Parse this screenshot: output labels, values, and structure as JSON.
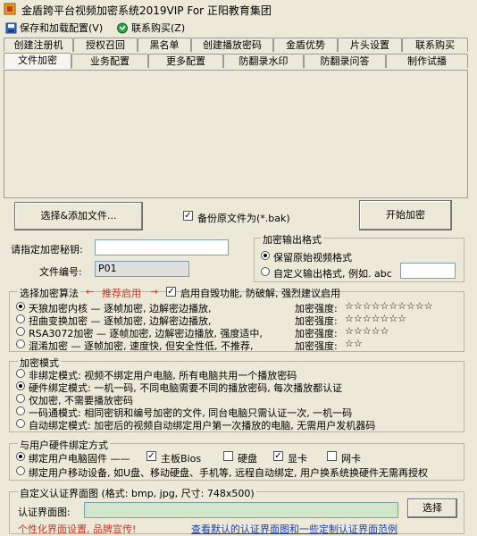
{
  "window": {
    "title": "金盾跨平台视频加密系统2019VIP For 正阳教育集团"
  },
  "menu": {
    "save_load": "保存和加载配置(V)",
    "contact": "联系购买(Z)"
  },
  "tabs_row1": [
    "创建注册机",
    "授权召回",
    "黑名单",
    "创建播放密码",
    "金盾优势",
    "片头设置",
    "联系购买"
  ],
  "tabs_row2": [
    "文件加密",
    "业务配置",
    "更多配置",
    "防翻录水印",
    "防翻录问答",
    "制作试播"
  ],
  "actions": {
    "select_add": "选择&添加文件...",
    "backup_label": "备份原文件为(*.bak)",
    "start_encrypt": "开始加密"
  },
  "key_form": {
    "key_label": "请指定加密秘钥:",
    "key_value": "",
    "file_no_label": "文件编号:",
    "file_no_value": "P01"
  },
  "output_format": {
    "title": "加密输出格式",
    "keep_original": "保留原始视频格式",
    "custom_label": "自定义输出格式, 例如. abc",
    "custom_value": ""
  },
  "algorithm": {
    "title": "选择加密算法",
    "arrow_left": "←",
    "recommend": "推荐启用",
    "arrow_right": "→",
    "self_check": "启用自毁功能, 防破解, 强烈建议启用",
    "strength_label": "加密强度:",
    "items": [
      {
        "text": "天狼加密内核 — 逐帧加密, 边解密边播放,",
        "stars": "☆☆☆☆☆☆☆☆☆☆"
      },
      {
        "text": "扭曲变换加密 — 逐帧加密, 边解密边播放,",
        "stars": "☆☆☆☆☆☆☆"
      },
      {
        "text": "RSA3072加密 — 逐帧加密, 边解密边播放, 强度适中,",
        "stars": "☆☆☆☆☆"
      },
      {
        "text": "混淆加密 — 逐帧加密, 速度快, 但安全性低, 不推荐,",
        "stars": "☆☆"
      }
    ]
  },
  "encrypt_mode": {
    "title": "加密模式",
    "items": [
      "非绑定模式: 视频不绑定用户电脑, 所有电脑共用一个播放密码",
      "硬件绑定模式: 一机一码, 不同电脑需要不同的播放密码, 每次播放都认证",
      "仅加密, 不需要播放密码",
      "一码通模式: 相同密钥和编号加密的文件, 同台电脑只需认证一次, 一机一码",
      "自动绑定模式: 加密后的视频自动绑定用户第一次播放的电脑, 无需用户发机器码"
    ]
  },
  "hardware": {
    "title": "与用户硬件绑定方式",
    "bind_pc": "绑定用户电脑固件 ——",
    "mainboard": "主板Bios",
    "disk": "硬盘",
    "gpu": "显卡",
    "nic": "网卡",
    "bind_mobile": "绑定用户移动设备, 如U盘、移动硬盘、手机等, 远程自动绑定, 用户换系统换硬件无需再授权"
  },
  "custom_auth": {
    "title": "自定义认证界面图 (格式: bmp, jpg, 尺寸: 748x500)",
    "image_label": "认证界面图:",
    "image_value": "",
    "select_button": "选择",
    "promo": "个性化界面设置, 品牌宣传!",
    "example_link": "查看默认的认证界面图和一些定制认证界面范例"
  },
  "colors": {
    "accent_red": "#c0392b",
    "link_blue": "#1a3fb8",
    "field_green": "#cfe6c8"
  }
}
